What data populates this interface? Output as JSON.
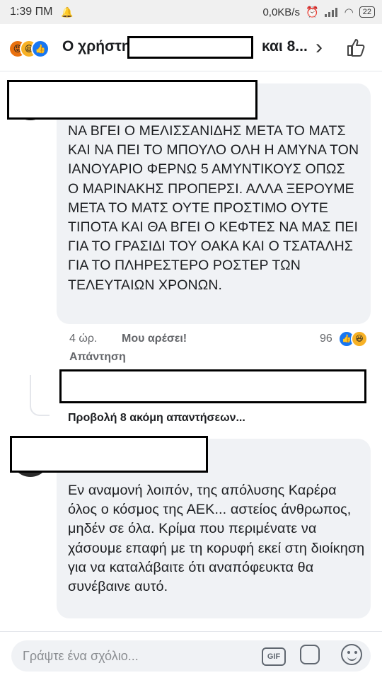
{
  "status_bar": {
    "time": "1:39 ΠΜ",
    "network": "0,0KB/s",
    "battery": "22"
  },
  "header": {
    "title_start": "Ο χρήστη",
    "title_end": "και 8...",
    "reactions": [
      "angry-icon",
      "haha-icon",
      "like-icon"
    ]
  },
  "comments": [
    {
      "text": "ΝΑ ΒΓΕΙ Ο ΜΕΛΙΣΣΑΝΙΔΗΣ ΜΕΤΑ ΤΟ ΜΑΤΣ ΚΑΙ ΝΑ ΠΕΙ ΤΟ ΜΠΟΥΛΟ ΟΛΗ Η ΑΜΥΝΑ ΤΟΝ ΙΑΝΟΥΑΡΙΟ ΦΕΡΝΩ 5 ΑΜΥΝΤΙΚΟΥΣ ΟΠΩΣ Ο ΜΑΡΙΝΑΚΗΣ ΠΡΟΠΕΡΣΙ. ΑΛΛΑ ΞΕΡΟΥΜΕ ΜΕΤΑ ΤΟ ΜΑΤΣ ΟΥΤΕ ΠΡΟΣΤΙΜΟ ΟΥΤΕ ΤΙΠΟΤΑ ΚΑΙ ΘΑ ΒΓΕΙ Ο ΚΕΦΤΕΣ ΝΑ ΜΑΣ ΠΕΙ ΓΙΑ ΤΟ ΓΡΑΣΙΔΙ ΤΟΥ ΟΑΚΑ ΚΑΙ Ο ΤΣΑΤΑΛΗΣ ΓΙΑ ΤΟ ΠΛΗΡΕΣΤΕΡΟ ΡΟΣΤΕΡ ΤΩΝ ΤΕΛΕΥΤΑΙΩΝ ΧΡΟΝΩΝ.",
      "time": "4 ώρ.",
      "like_label": "Μου αρέσει!",
      "reply_label": "Απάντηση",
      "reaction_count": "96",
      "more_replies": "Προβολή 8 ακόμη απαντήσεων..."
    },
    {
      "text": "Εν αναμονή λοιπόν, της απόλυσης Καρέρα όλος ο κόσμος της ΑΕΚ... αστείος άνθρωπος, μηδέν σε όλα. Κρίμα που περιμένατε να χάσουμε επαφή με τη κορυφή εκεί στη διοίκηση για να καταλάβαιτε ότι αναπόφευκτα θα συνέβαινε αυτό."
    }
  ],
  "composer": {
    "placeholder": "Γράψτε ένα σχόλιο...",
    "gif_label": "GIF"
  }
}
